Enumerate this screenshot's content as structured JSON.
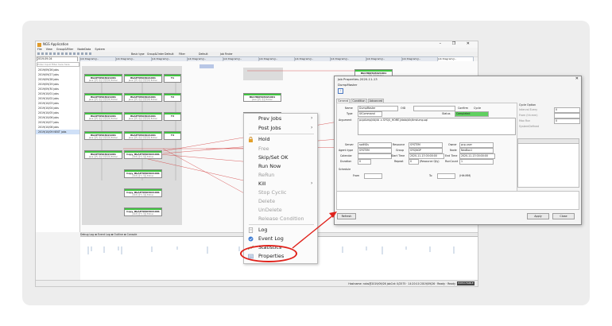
{
  "window": {
    "title": "NGS Application",
    "controls": "– ❐ ✕",
    "menu": [
      "File",
      "View",
      "Group&Filter",
      "NodeData",
      "System"
    ],
    "toolbar_texts": [
      "Basic type",
      "Group&Order",
      "Default",
      "Filter",
      "Default",
      "Job Finder"
    ],
    "date_value": "2019-09-04",
    "filter_placeholder": "Enter Input Filter here here"
  },
  "job_tabs": [
    "Job Diagram(J...",
    "Job Diagram(J...",
    "Job Diagram(J...",
    "Job Diagram(J...",
    "Job Diagram(J...",
    "Job Diagram(J...",
    "Job Diagram(J...",
    "Job Diagram(J...",
    "Job Diagram(J...",
    "Job Diagram(J...",
    "Job Diagram(J..."
  ],
  "tree": {
    "items": [
      "2019/09/26 jobs",
      "2019/09/27 jobs",
      "2019/09/28 jobs",
      "2019/09/29 jobs",
      "2019/09/30 jobs",
      "2019/10/01 jobs",
      "2019/10/02 jobs",
      "2019/10/03 jobs",
      "2019/10/04 jobs",
      "2019/10/05 jobs",
      "2019/10/06 jobs",
      "2019/10/07 jobs",
      "2019/10/08 jobs",
      "2019/10/09 NEXT jobs"
    ],
    "selected_index": 13
  },
  "nodes": [
    {
      "name": "BbAPT0503021001",
      "sub": "Java 형식 가장 전달일자 Extrac"
    },
    {
      "name": "BbAPT0503021001",
      "sub": "Java 형식 가장 전달일자 Extrac"
    },
    {
      "name": "BbAPT0503021001",
      "sub": "Java 형식 가장 전달일자 Extrac"
    },
    {
      "name": "BbAPT0503021001",
      "sub": "Java 형식 가장 전달일자 Extrac"
    },
    {
      "name": "BbAPT0503021001",
      "sub": "Java 형식 가장 전달일자 Extrac"
    },
    {
      "name": "BbAPT0503021001",
      "sub": "Java 형식 가장 전달일자 Extrac"
    },
    {
      "name": "BbAPT0503021001",
      "sub": "Java 형식 가장 전달일자 Extrac"
    },
    {
      "name": "BbAPT0503021001",
      "sub": "Java 형식 가장 전달일자 Extrac"
    },
    {
      "name": "Copy_BbAPT0503021001",
      "sub": "Job의 형식 가장 Extrac"
    },
    {
      "name": "Copy_BbAPT0503021001",
      "sub": "Job의 형식 가장 Extrac"
    },
    {
      "name": "Copy_BbAPT0503021001",
      "sub": "Job의 형식 가장 Extrac"
    },
    {
      "name": "Copy_BbAPT0503021001",
      "sub": "Job의 형식 가장 Extrac"
    },
    {
      "name": "BbAPT0503021001",
      "sub": "Java 형식 가장 전달일자 Extrac"
    },
    {
      "name": "BbCHK0503021001",
      "sub": "Java 형식 가장 Extrac"
    },
    {
      "name": "BbCHK0503021001",
      "sub": "Java 형식 가장 Extrac"
    },
    {
      "name": "BbCHK0503021001",
      "sub": "Java 형식 가장 Extrac"
    },
    {
      "name": "BbCHK0503021001",
      "sub": "Java 형식 가장 Extrac"
    },
    {
      "name": "BbCHK0503021001",
      "sub": "Java 형식 가장 Extrac"
    },
    {
      "name": "BbCHK0503021001",
      "sub": "Java 형식 가장 Extrac"
    },
    {
      "name": "BbCHK0503021001",
      "sub": "Java 형식 가장 Extrac"
    }
  ],
  "small_nodes": [
    "T1",
    "T2",
    "T3",
    "T4"
  ],
  "bottom_tabs": "Debug Log ⊠ Event Log ⊠ Outline ⊠ Console",
  "status": {
    "text": "Hostname: ncbs@2019/09/26 jobCnt: 0/2575 · 14:20:10 2019/09/26 · Ready · Ready",
    "chip": "EXECUTABLE"
  },
  "context_menu": {
    "items": [
      {
        "label": "Prev Jobs",
        "disabled": false,
        "submenu": true
      },
      {
        "label": "Post Jobs",
        "disabled": false,
        "submenu": true
      },
      {
        "label": "Hold",
        "disabled": false,
        "submenu": false
      },
      {
        "label": "Free",
        "disabled": true,
        "submenu": false
      },
      {
        "label": "Skip/Set OK",
        "disabled": false,
        "submenu": false
      },
      {
        "label": "Run Now",
        "disabled": false,
        "submenu": false
      },
      {
        "label": "ReRun",
        "disabled": true,
        "submenu": false
      },
      {
        "label": "Kill",
        "disabled": false,
        "submenu": true
      },
      {
        "label": "Stop Cyclic",
        "disabled": true,
        "submenu": false
      },
      {
        "label": "Delete",
        "disabled": true,
        "submenu": false
      },
      {
        "label": "UnDelete",
        "disabled": true,
        "submenu": false
      },
      {
        "label": "Release Condition",
        "disabled": true,
        "submenu": false
      },
      {
        "label": "Log",
        "disabled": false,
        "submenu": false
      },
      {
        "label": "Event Log",
        "disabled": false,
        "submenu": false
      },
      {
        "label": "Statistics",
        "disabled": false,
        "submenu": false
      },
      {
        "label": "Properties",
        "disabled": false,
        "submenu": false
      }
    ]
  },
  "dialog": {
    "title": "Job Properties-2020-11-13",
    "job_name": "DumpMaster",
    "close": "✕",
    "tabs": [
      "General",
      "Condition",
      "Advanced"
    ],
    "labels": {
      "name": "Name",
      "type": "Type",
      "argument": "Argument",
      "oid": "OID",
      "confirm": "Confirm",
      "cycle": "Cycle",
      "status": "Status",
      "server": "Server",
      "resource": "Resource",
      "owner": "Owner",
      "agent_type": "Agent type",
      "group": "Group",
      "node": "Node",
      "calendar": "Calendar",
      "start_time": "Start Time",
      "end_time": "End Time",
      "duration": "Duration",
      "repeat": "Repeat",
      "run_count": "RunCount",
      "resource_qty": "(Resource Qty)",
      "schedule": "Schedule",
      "from": "From",
      "to": "To",
      "hhmm": "(HH:MM)",
      "cycle_option": "Cycle Option",
      "interval_every": "Interval Every",
      "from_hhmm": "From (hh:mm)",
      "max_run": "Max Run",
      "system_defined": "SystemDefined"
    },
    "values": {
      "name": "DumpMaster",
      "type": "UICommand",
      "oid": "",
      "status": "Completed",
      "argument": "pcpdump/nb/vb -s SYS(0_HOME)/data/dir/dmdump.sql",
      "server": "ssdNGs",
      "resource": "SYSTEM",
      "owner": "pcp-user",
      "agent_type": "SYSTEM",
      "group": "SYS/NGP",
      "node": "NexBox1",
      "calendar": "",
      "start_time": "2020-11-13 00:00:00",
      "end_time": "2020-11-13 00:00:00",
      "duration": "0",
      "repeat": "0",
      "run_count": "1",
      "resource_qty": "0",
      "interval": "0",
      "max_run": "0"
    },
    "buttons": {
      "refresh": "Refresh",
      "apply": "Apply",
      "close": "Close"
    }
  }
}
